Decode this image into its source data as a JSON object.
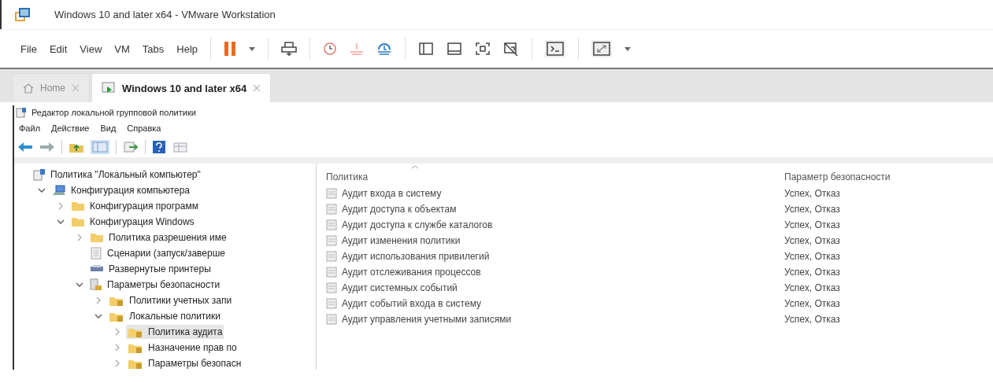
{
  "window": {
    "title": "Windows 10 and later x64 - VMware Workstation"
  },
  "menu": [
    "File",
    "Edit",
    "View",
    "VM",
    "Tabs",
    "Help"
  ],
  "tabs": [
    {
      "label": "Home",
      "selected": false
    },
    {
      "label": "Windows 10 and later x64",
      "selected": true
    }
  ],
  "guest": {
    "title": "Редактор локальной групповой политики",
    "menu": [
      "Файл",
      "Действие",
      "Вид",
      "Справка"
    ],
    "tree": [
      {
        "label": "Политика \"Локальный компьютер\"",
        "kind": "policy",
        "selected": false,
        "children": [
          {
            "label": "Конфигурация компьютера",
            "kind": "computer",
            "expanded": true,
            "selected": false,
            "children": [
              {
                "label": "Конфигурация программ",
                "kind": "folder",
                "expanded": false,
                "selected": false
              },
              {
                "label": "Конфигурация Windows",
                "kind": "folder",
                "expanded": true,
                "selected": false,
                "children": [
                  {
                    "label": "Политика разрешения име",
                    "kind": "folder",
                    "expanded": false,
                    "selected": false
                  },
                  {
                    "label": "Сценарии (запуск/заверше",
                    "kind": "script",
                    "selected": false
                  },
                  {
                    "label": "Развернутые принтеры",
                    "kind": "printer",
                    "selected": false
                  },
                  {
                    "label": "Параметры безопасности",
                    "kind": "security",
                    "expanded": true,
                    "selected": false,
                    "children": [
                      {
                        "label": "Политики учетных запи",
                        "kind": "secfolder",
                        "expanded": false,
                        "selected": false
                      },
                      {
                        "label": "Локальные политики",
                        "kind": "secfolder",
                        "expanded": true,
                        "selected": false,
                        "children": [
                          {
                            "label": "Политика аудита",
                            "kind": "secfolder",
                            "expanded": false,
                            "selected": true
                          },
                          {
                            "label": "Назначение прав по",
                            "kind": "secfolder",
                            "expanded": false,
                            "selected": false
                          },
                          {
                            "label": "Параметры безопасн",
                            "kind": "secfolder",
                            "expanded": false,
                            "selected": false
                          }
                        ]
                      }
                    ]
                  }
                ]
              }
            ]
          }
        ]
      }
    ],
    "table": {
      "columns": [
        "Политика",
        "Параметр безопасности"
      ],
      "rows": [
        [
          "Аудит входа в систему",
          "Успех, Отказ"
        ],
        [
          "Аудит доступа к объектам",
          "Успех, Отказ"
        ],
        [
          "Аудит доступа к службе каталогов",
          "Успех, Отказ"
        ],
        [
          "Аудит изменения политики",
          "Успех, Отказ"
        ],
        [
          "Аудит использования привилегий",
          "Успех, Отказ"
        ],
        [
          "Аудит отслеживания процессов",
          "Успех, Отказ"
        ],
        [
          "Аудит системных событий",
          "Успех, Отказ"
        ],
        [
          "Аудит событий входа в систему",
          "Успех, Отказ"
        ],
        [
          "Аудит управления учетными записями",
          "Успех, Отказ"
        ]
      ]
    }
  }
}
